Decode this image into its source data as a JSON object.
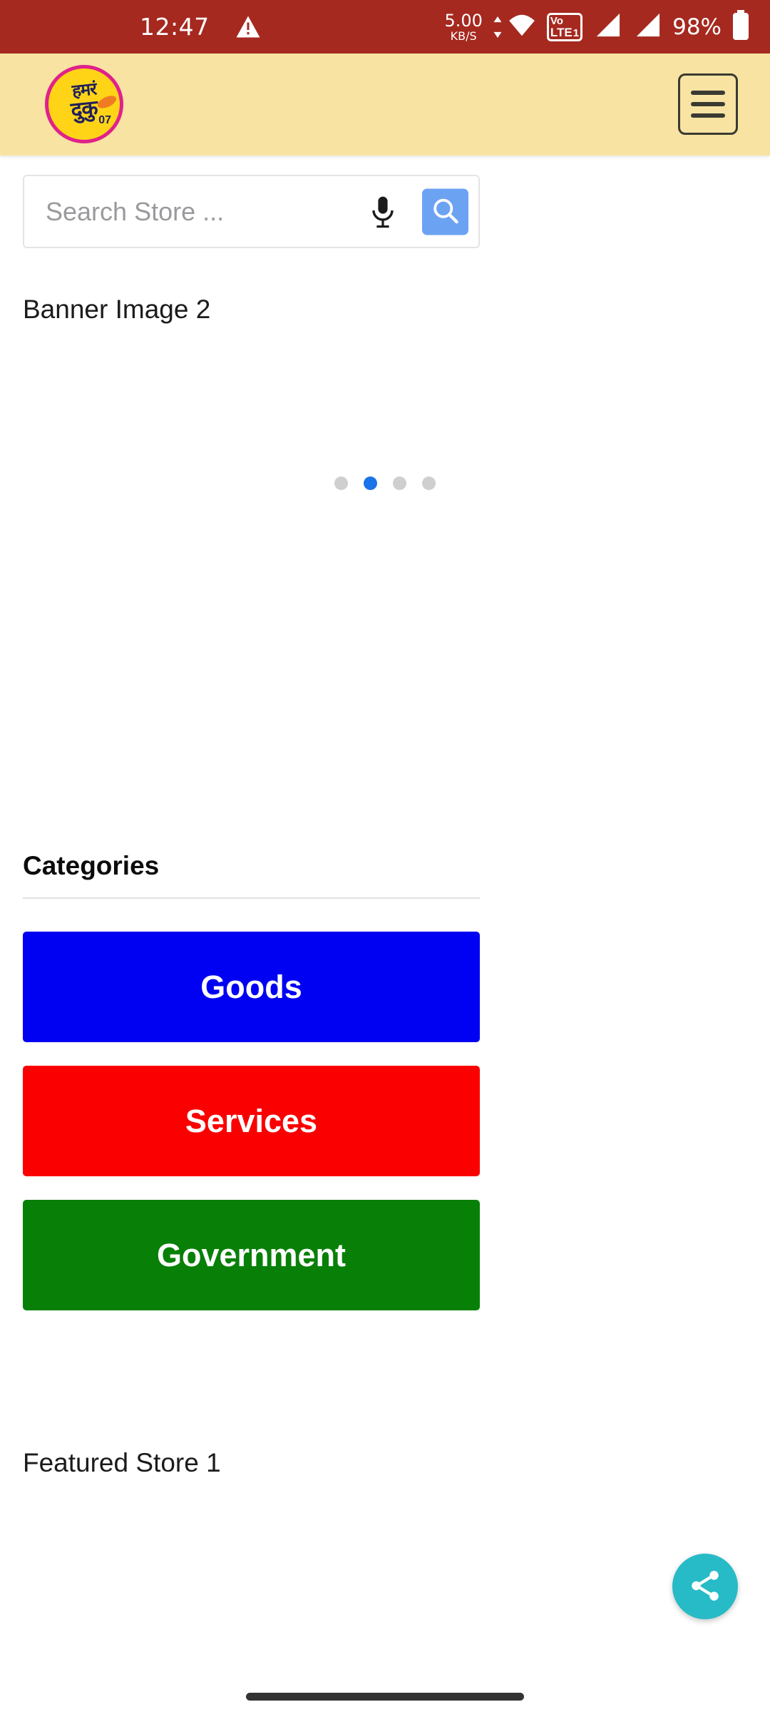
{
  "status_bar": {
    "background": "#a5291f",
    "time": "12:47",
    "warning_icon": "warning-triangle-icon",
    "net_speed_value": "5.00",
    "net_speed_unit": "KB/S",
    "wifi_icon": "wifi-icon",
    "volte": {
      "vo": "Vo",
      "lte": "LTE",
      "sim_number": "1"
    },
    "signal_1_icon": "signal-bars-icon",
    "signal_2_icon": "signal-bars-icon",
    "battery_percent": "98%",
    "battery_icon": "battery-full-icon"
  },
  "app_header": {
    "background": "#f8e3a3",
    "logo": {
      "name": "app-logo",
      "line1": "हमरं",
      "line2": "दुकु",
      "badge_number": "07",
      "circle_color": "#ffd417",
      "border_color": "#e0218a"
    },
    "menu_button": {
      "name": "hamburger-menu-button"
    }
  },
  "search": {
    "placeholder": "Search Store ...",
    "value": "",
    "mic_icon": "microphone-icon",
    "search_icon": "search-icon",
    "search_button_color": "#6ca2f2"
  },
  "banner": {
    "label": "Banner Image 2",
    "dots": [
      {
        "active": false
      },
      {
        "active": true
      },
      {
        "active": false
      },
      {
        "active": false
      }
    ],
    "active_dot_color": "#1a73e8",
    "inactive_dot_color": "#cfcfcf"
  },
  "categories": {
    "heading": "Categories",
    "items": [
      {
        "label": "Goods",
        "color": "#0000f2"
      },
      {
        "label": "Services",
        "color": "#fa0000"
      },
      {
        "label": "Government",
        "color": "#088008"
      }
    ]
  },
  "featured": {
    "label": "Featured Store 1"
  },
  "share_fab": {
    "icon": "share-icon",
    "color": "#26bbc6"
  },
  "nav_bar": {
    "gesture_pill": "home-gesture-pill"
  }
}
